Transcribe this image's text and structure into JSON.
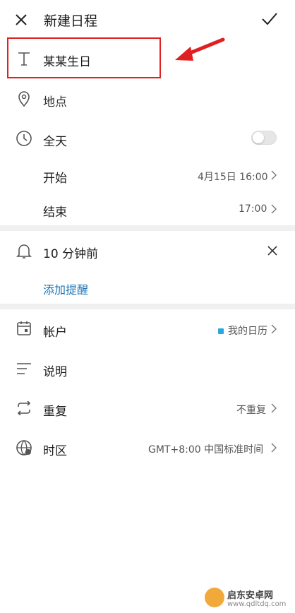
{
  "header": {
    "title": "新建日程",
    "close_icon": "close-icon",
    "confirm_icon": "check-icon"
  },
  "title_field": {
    "value": "某某生日",
    "icon": "text-icon",
    "highlight_color": "#e02020"
  },
  "location": {
    "placeholder": "地点",
    "icon": "location-pin-icon"
  },
  "all_day": {
    "label": "全天",
    "icon": "clock-icon",
    "enabled": false
  },
  "start": {
    "label": "开始",
    "value": "4月15日 16:00"
  },
  "end": {
    "label": "结束",
    "value": "17:00"
  },
  "reminder": {
    "label": "10 分钟前",
    "icon": "bell-icon",
    "add_label": "添加提醒",
    "add_color": "#1a73b8"
  },
  "account": {
    "label": "帐户",
    "value": "我的日历",
    "icon": "calendar-icon",
    "dot_color": "#2aa7e0"
  },
  "description": {
    "label": "说明",
    "icon": "lines-icon"
  },
  "repeat": {
    "label": "重复",
    "value": "不重复",
    "icon": "repeat-icon"
  },
  "timezone": {
    "label": "时区",
    "value": "GMT+8:00 中国标准时间",
    "icon": "globe-icon"
  },
  "watermark": {
    "name": "启东安卓网",
    "url": "www.qdltdq.com"
  }
}
